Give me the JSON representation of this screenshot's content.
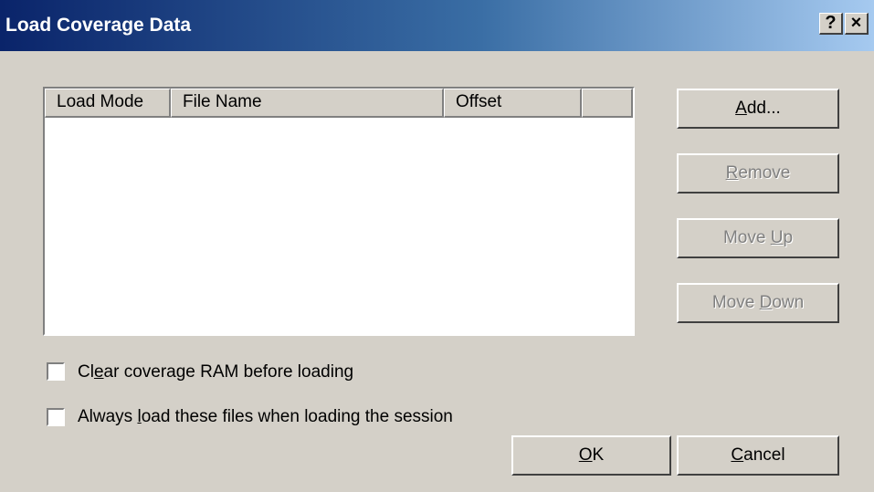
{
  "window": {
    "title": "Load Coverage Data",
    "help_label": "?",
    "close_label": "×"
  },
  "list": {
    "columns": [
      "Load Mode",
      "File Name",
      "Offset",
      ""
    ],
    "rows": []
  },
  "buttons": {
    "add": {
      "pre": "",
      "mn": "A",
      "post": "dd..."
    },
    "remove": {
      "pre": "",
      "mn": "R",
      "post": "emove"
    },
    "move_up": {
      "pre": "Move ",
      "mn": "U",
      "post": "p"
    },
    "move_down": {
      "pre": "Move ",
      "mn": "D",
      "post": "own"
    },
    "ok": {
      "pre": "",
      "mn": "O",
      "post": "K"
    },
    "cancel": {
      "pre": "",
      "mn": "C",
      "post": "ancel"
    }
  },
  "options": {
    "clear_ram": {
      "pre": "Cl",
      "mn": "e",
      "post": "ar coverage RAM before loading",
      "checked": false
    },
    "always_load": {
      "pre": "Always ",
      "mn": "l",
      "post": "oad these files when loading the session",
      "checked": false
    }
  }
}
